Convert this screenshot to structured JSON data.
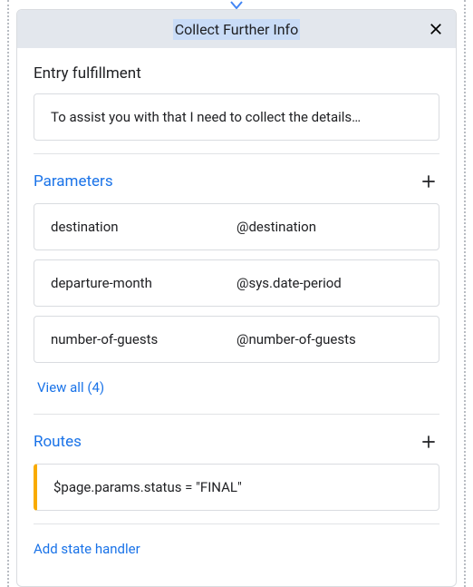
{
  "header": {
    "title": "Collect Further Info"
  },
  "entry": {
    "heading": "Entry fulfillment",
    "message": "To assist you with that I need to collect the details…"
  },
  "parameters": {
    "heading": "Parameters",
    "items": [
      {
        "name": "destination",
        "entity": "@destination"
      },
      {
        "name": "departure-month",
        "entity": "@sys.date-period"
      },
      {
        "name": "number-of-guests",
        "entity": "@number-of-guests"
      }
    ],
    "view_all_label": "View all (4)"
  },
  "routes": {
    "heading": "Routes",
    "items": [
      {
        "condition": "$page.params.status = \"FINAL\""
      }
    ]
  },
  "footer": {
    "add_state_label": "Add state handler"
  }
}
